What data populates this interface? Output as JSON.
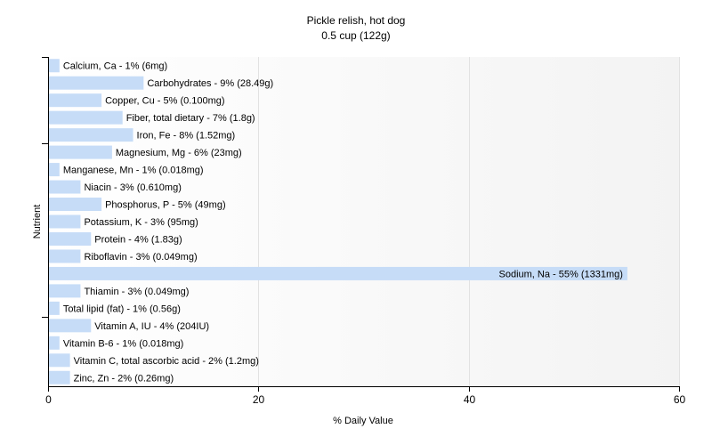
{
  "chart_data": {
    "type": "bar",
    "orientation": "horizontal",
    "title": "Pickle relish, hot dog",
    "subtitle": "0.5 cup (122g)",
    "xlabel": "% Daily Value",
    "ylabel": "Nutrient",
    "xlim": [
      0,
      60
    ],
    "xticks": [
      0,
      20,
      40,
      60
    ],
    "grid": true,
    "bar_color": "#c6dcf7",
    "categories": [
      "Calcium, Ca",
      "Carbohydrates",
      "Copper, Cu",
      "Fiber, total dietary",
      "Iron, Fe",
      "Magnesium, Mg",
      "Manganese, Mn",
      "Niacin",
      "Phosphorus, P",
      "Potassium, K",
      "Protein",
      "Riboflavin",
      "Sodium, Na",
      "Thiamin",
      "Total lipid (fat)",
      "Vitamin A, IU",
      "Vitamin B-6",
      "Vitamin C, total ascorbic acid",
      "Zinc, Zn"
    ],
    "values": [
      1,
      9,
      5,
      7,
      8,
      6,
      1,
      3,
      5,
      3,
      4,
      3,
      55,
      3,
      1,
      4,
      1,
      2,
      2
    ],
    "labels": [
      "Calcium, Ca - 1% (6mg)",
      "Carbohydrates - 9% (28.49g)",
      "Copper, Cu - 5% (0.100mg)",
      "Fiber, total dietary - 7% (1.8g)",
      "Iron, Fe - 8% (1.52mg)",
      "Magnesium, Mg - 6% (23mg)",
      "Manganese, Mn - 1% (0.018mg)",
      "Niacin - 3% (0.610mg)",
      "Phosphorus, P - 5% (49mg)",
      "Potassium, K - 3% (95mg)",
      "Protein - 4% (1.83g)",
      "Riboflavin - 3% (0.049mg)",
      "Sodium, Na - 55% (1331mg)",
      "Thiamin - 3% (0.049mg)",
      "Total lipid (fat) - 1% (0.56g)",
      "Vitamin A, IU - 4% (204IU)",
      "Vitamin B-6 - 1% (0.018mg)",
      "Vitamin C, total ascorbic acid - 2% (1.2mg)",
      "Zinc, Zn - 2% (0.26mg)"
    ]
  }
}
